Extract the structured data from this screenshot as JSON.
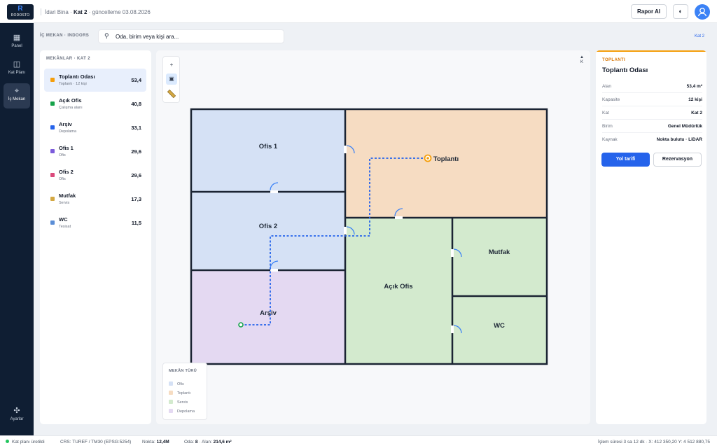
{
  "header": {
    "logo_text": "RODOSTO",
    "logo_mark": "R",
    "building": "İdari Bina",
    "sep": "·",
    "floor": "Kat 2",
    "updated": "· güncelleme 03.08.2026",
    "rapor_button": "Rapor Al",
    "theme_icon": "◐",
    "avatar_icon": "👤"
  },
  "sidebar": {
    "items": [
      {
        "label": "Panel",
        "icon": "grid-icon",
        "glyph": "▦"
      },
      {
        "label": "Kat Planı",
        "icon": "floorplan-icon",
        "glyph": "◫"
      },
      {
        "label": "İç Mekan",
        "icon": "location-pin-icon",
        "glyph": "⌖"
      },
      {
        "label": "Ayarlar",
        "icon": "settings-icon",
        "glyph": "✣"
      }
    ]
  },
  "search": {
    "section_label": "İÇ MEKAN · INDOORS",
    "placeholder": "Oda, birim veya kişi ara...",
    "floor_link": "Kat 2"
  },
  "rooms_panel": {
    "title": "MEKÂNLAR · KAT 2",
    "rooms": [
      {
        "name": "Toplantı Odası",
        "sub": "Toplantı · 12 kişi",
        "value": "53,4",
        "color": "#f59e0b"
      },
      {
        "name": "Açık Ofis",
        "sub": "Çalışma alanı",
        "value": "40,8",
        "color": "#16a34a"
      },
      {
        "name": "Arşiv",
        "sub": "Depolama",
        "value": "33,1",
        "color": "#2563eb"
      },
      {
        "name": "Ofis 1",
        "sub": "Ofis",
        "value": "29,6",
        "color": "#7c5cdb"
      },
      {
        "name": "Ofis 2",
        "sub": "Ofis",
        "value": "29,6",
        "color": "#db4a7c"
      },
      {
        "name": "Mutfak",
        "sub": "Servis",
        "value": "17,3",
        "color": "#d4a843"
      },
      {
        "name": "WC",
        "sub": "Tesisat",
        "value": "11,5",
        "color": "#5b8ed6"
      }
    ]
  },
  "map": {
    "tools": [
      {
        "name": "zoom-in-icon",
        "glyph": "+"
      },
      {
        "name": "select-icon",
        "glyph": "▣"
      },
      {
        "name": "measure-icon",
        "glyph": "📏"
      }
    ],
    "compass": {
      "arrow": "▲",
      "letter": "K"
    },
    "labels": {
      "ofis1": "Ofis 1",
      "ofis2": "Ofis 2",
      "arsiv": "Arşiv",
      "toplanti": "Toplantı",
      "acik_ofis": "Açık Ofis",
      "mutfak": "Mutfak",
      "wc": "WC"
    },
    "colors": {
      "ofis": "#d5e1f5",
      "toplanti": "#f6dcc2",
      "servis": "#d3eace",
      "depolama": "#e4d9f2",
      "wall": "#1b2433",
      "route": "#2563eb",
      "door": "#3b82f6"
    },
    "legend": {
      "title": "MEKÂN TÜRÜ",
      "items": [
        {
          "label": "Ofis",
          "color": "#d5e1f5"
        },
        {
          "label": "Toplantı",
          "color": "#f6dcc2"
        },
        {
          "label": "Servis",
          "color": "#d3eace"
        },
        {
          "label": "Depolama",
          "color": "#e4d9f2"
        }
      ]
    }
  },
  "detail": {
    "type": "TOPLANTI",
    "name": "Toplantı Odası",
    "props": [
      {
        "k": "Alan",
        "v": "53,4 m²"
      },
      {
        "k": "Kapasite",
        "v": "12 kişi"
      },
      {
        "k": "Kat",
        "v": "Kat 2"
      },
      {
        "k": "Birim",
        "v": "Genel Müdürlük"
      },
      {
        "k": "Kaynak",
        "v": "Nokta bulutu · LiDAR"
      }
    ],
    "route_button": "Yol tarifi",
    "reserve_button": "Rezervasyon"
  },
  "status": {
    "generated": "Kat planı üretildi",
    "crs": "CRS: TUREF / TM30 (EPSG:5254)",
    "points_label": "Nokta:",
    "points_value": "12,4M",
    "rooms_label": "Oda:",
    "rooms_value": "8",
    "area_label": "· Alan:",
    "area_value": "214,6 m²",
    "right": "İşlem süresi 3 sa 12 dk · X: 412 350,20 Y: 4 512 880,75"
  }
}
